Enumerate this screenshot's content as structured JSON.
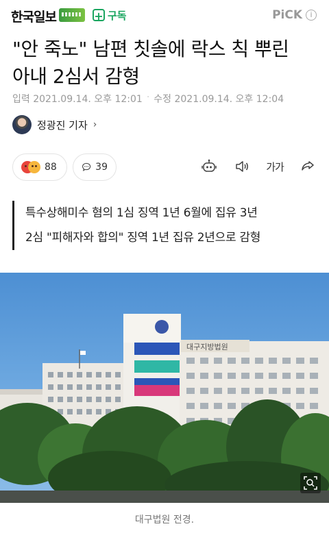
{
  "header": {
    "logo": "한국일보",
    "subscribe_label": "구독",
    "pick_label": "PiCK"
  },
  "article": {
    "title_line1": "\"안 죽노\" 남편 칫솔에 락스 칙 뿌린",
    "title_line2": "아내 2심서 감형",
    "published": "입력 2021.09.14. 오후 12:01",
    "modified": "수정 2021.09.14. 오후 12:04",
    "reporter": "정광진 기자"
  },
  "reactions": {
    "emotion_count": "88",
    "comment_count": "39"
  },
  "tools": {
    "font_label": "가가"
  },
  "summary": {
    "line1": "특수상해미수 혐의 1심 징역 1년 6월에 집유 3년",
    "line2": "2심 \"피해자와 합의\" 징역 1년 집유 2년으로 감형"
  },
  "photo": {
    "sign_text": "대구지방법원",
    "caption": "대구법원 전경."
  },
  "colors": {
    "accent_green": "#19a55f",
    "sky": "#5b9bdc"
  },
  "icons": [
    "plus-icon",
    "info-icon",
    "chevron-right-icon",
    "angry-emoji-icon",
    "sad-emoji-icon",
    "comment-icon",
    "robot-read-icon",
    "speaker-icon",
    "share-icon",
    "zoom-icon"
  ]
}
